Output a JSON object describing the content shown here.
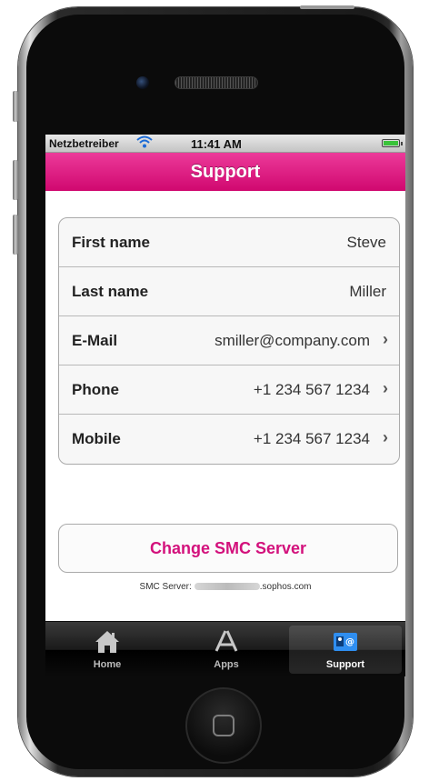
{
  "status_bar": {
    "carrier": "Netzbetreiber",
    "time": "11:41 AM",
    "wifi_icon": "wifi-icon",
    "battery_icon": "battery-icon",
    "battery_level": 1.0,
    "battery_color": "#3ac33a"
  },
  "nav": {
    "title": "Support",
    "accent": "#d3117c"
  },
  "contact": {
    "rows": [
      {
        "label": "First name",
        "value": "Steve",
        "chevron": false
      },
      {
        "label": "Last name",
        "value": "Miller",
        "chevron": false
      },
      {
        "label": "E-Mail",
        "value": "smiller@company.com",
        "chevron": true
      },
      {
        "label": "Phone",
        "value": "+1 234 567 1234",
        "chevron": true
      },
      {
        "label": "Mobile",
        "value": "+1 234 567 1234",
        "chevron": true
      }
    ]
  },
  "change_button": {
    "label": "Change SMC Server"
  },
  "server": {
    "label": "SMC Server:",
    "domain_suffix": ".sophos.com"
  },
  "tabs": [
    {
      "label": "Home",
      "icon": "house-icon",
      "active": false
    },
    {
      "label": "Apps",
      "icon": "app-store-icon",
      "active": false
    },
    {
      "label": "Support",
      "icon": "contact-card-icon",
      "active": true
    }
  ]
}
